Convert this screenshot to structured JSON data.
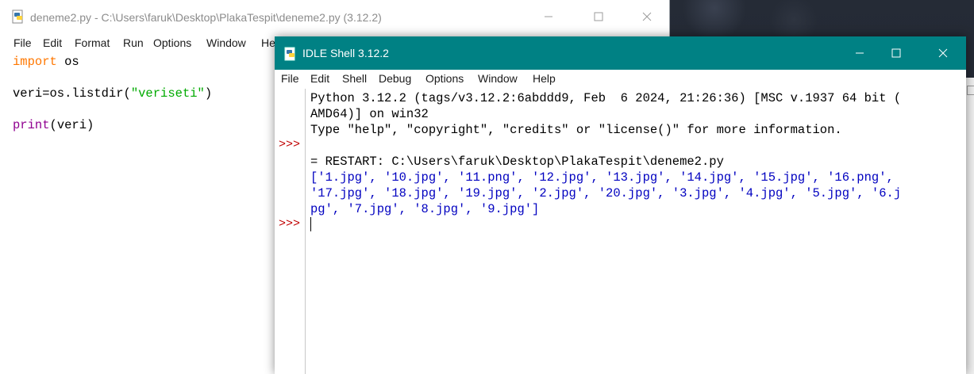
{
  "editor": {
    "title": "deneme2.py - C:\\Users\\faruk\\Desktop\\PlakaTespit\\deneme2.py (3.12.2)",
    "menu": [
      "File",
      "Edit",
      "Format",
      "Run",
      "Options",
      "Window",
      "He"
    ],
    "code": {
      "line1_kw": "import",
      "line1_rest": " os",
      "line3_pre": "veri=os.listdir(",
      "line3_str": "\"veriseti\"",
      "line3_post": ")",
      "line5_kw": "print",
      "line5_rest": "(veri)"
    }
  },
  "shell": {
    "title": "IDLE Shell 3.12.2",
    "menu": [
      "File",
      "Edit",
      "Shell",
      "Debug",
      "Options",
      "Window",
      "Help"
    ],
    "prompt": ">>>",
    "lines": [
      "Python 3.12.2 (tags/v3.12.2:6abddd9, Feb  6 2024, 21:26:36) [MSC v.1937 64 bit (",
      "AMD64)] on win32",
      "Type \"help\", \"copyright\", \"credits\" or \"license()\" for more information.",
      "",
      "= RESTART: C:\\Users\\faruk\\Desktop\\PlakaTespit\\deneme2.py",
      "['1.jpg', '10.jpg', '11.png', '12.jpg', '13.jpg', '14.jpg', '15.jpg', '16.png',",
      "'17.jpg', '18.jpg', '19.jpg', '2.jpg', '20.jpg', '3.jpg', '4.jpg', '5.jpg', '6.j",
      "pg', '7.jpg', '8.jpg', '9.jpg']"
    ]
  },
  "icons": {
    "app": "python-idle-icon",
    "minimize": "minimize-icon",
    "maximize": "maximize-icon",
    "close": "close-icon"
  },
  "colors": {
    "shell_titlebar": "#008184",
    "prompt": "#c00000",
    "output_blue": "#0000c0",
    "keyword_import": "#ff7700",
    "keyword_print": "#900090",
    "string": "#00aa00"
  }
}
